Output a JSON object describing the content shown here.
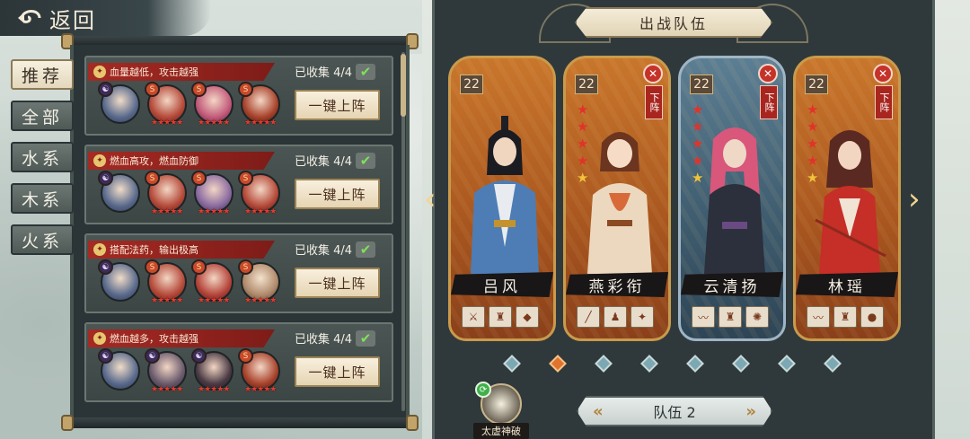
{
  "header": {
    "back_label": "返回"
  },
  "filters": [
    {
      "label": "推荐",
      "active": true
    },
    {
      "label": "全部",
      "active": false
    },
    {
      "label": "水系",
      "active": false
    },
    {
      "label": "木系",
      "active": false
    },
    {
      "label": "火系",
      "active": false
    }
  ],
  "teams": [
    {
      "desc": "血量越低，攻击越强",
      "collected": "已收集 4/4",
      "button": "一键上阵"
    },
    {
      "desc": "燃血高攻，燃血防御",
      "collected": "已收集 4/4",
      "button": "一键上阵"
    },
    {
      "desc": "搭配法药，输出极高",
      "collected": "已收集 4/4",
      "button": "一键上阵"
    },
    {
      "desc": "燃血越多，攻击越强",
      "collected": "已收集 4/4",
      "button": "一键上阵"
    }
  ],
  "lineup": {
    "title": "出战队伍",
    "team_label": "队伍 2",
    "skill_label": "太虚神破",
    "remove_label": "下阵",
    "heroes": [
      {
        "name": "吕风",
        "level": "22",
        "stars": 0,
        "removable": false,
        "theme": "orange"
      },
      {
        "name": "燕彩衔",
        "level": "22",
        "stars": 5,
        "removable": true,
        "theme": "orange"
      },
      {
        "name": "云清扬",
        "level": "22",
        "stars": 5,
        "removable": true,
        "theme": "blue"
      },
      {
        "name": "林瑶",
        "level": "22",
        "stars": 5,
        "removable": true,
        "theme": "orange"
      }
    ],
    "page_count": 8,
    "active_page": 2
  },
  "colors": {
    "accent_red": "#a52a24",
    "gold": "#c99a4c",
    "panel": "#2b3437"
  },
  "icons": [
    "back-swirl-icon",
    "taiji-icon",
    "fire-icon",
    "check-icon",
    "close-icon",
    "chevron-left-icon",
    "chevron-right-icon",
    "swap-icon"
  ]
}
